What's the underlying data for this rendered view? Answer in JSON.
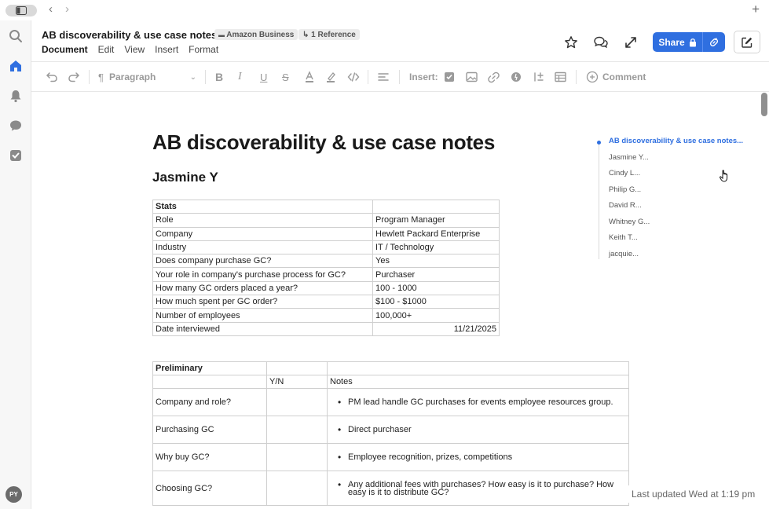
{
  "window": {
    "back_arrow": "‹",
    "forward_arrow": "›",
    "new_tab": "+"
  },
  "doc": {
    "title": "AB discoverability & use case notes",
    "folder_chip": "Amazon Business",
    "reference_chip": "1 Reference"
  },
  "menu": [
    "Document",
    "Edit",
    "View",
    "Insert",
    "Format"
  ],
  "share": {
    "label": "Share"
  },
  "toolbar": {
    "paragraph_style": "Paragraph",
    "insert_label": "Insert:",
    "comment_label": "Comment"
  },
  "content": {
    "heading": "AB discoverability & use case notes",
    "subheading": "Jasmine Y",
    "stats_table": {
      "header": "Stats",
      "rows": [
        [
          "Role",
          "Program Manager"
        ],
        [
          "Company",
          "Hewlett Packard Enterprise"
        ],
        [
          "Industry",
          "IT / Technology"
        ],
        [
          "Does company purchase GC?",
          "Yes"
        ],
        [
          "Your role in company's purchase process for GC?",
          "Purchaser"
        ],
        [
          "How many GC orders placed a year?",
          "100 - 1000"
        ],
        [
          "How much spent per GC order?",
          "$100 - $1000"
        ],
        [
          "Number of employees",
          "100,000+"
        ],
        [
          "Date interviewed",
          "11/21/2025"
        ]
      ]
    },
    "prelim_table": {
      "header": "Preliminary",
      "col_yn": "Y/N",
      "col_notes": "Notes",
      "rows": [
        {
          "question": "Company and role?",
          "yn": "",
          "notes": [
            "PM lead handle GC purchases for events employee resources group."
          ]
        },
        {
          "question": "Purchasing GC",
          "yn": "",
          "notes": [
            " Direct purchaser"
          ]
        },
        {
          "question": "Why buy GC?",
          "yn": "",
          "notes": [
            "Employee recognition, prizes, competitions"
          ]
        },
        {
          "question": "Choosing GC?",
          "yn": "",
          "notes": [
            "Any additional fees with purchases? How easy is it to purchase? How easy is it to distribute GC?"
          ]
        }
      ]
    }
  },
  "outline": {
    "items": [
      "AB discoverability & use case notes...",
      "Jasmine Y...",
      "Cindy L...",
      "Philip G...",
      "David R...",
      "Whitney G...",
      "Keith T...",
      "jacquie..."
    ]
  },
  "status": {
    "last_updated": "Last updated Wed at 1:19 pm"
  },
  "user": {
    "initials": "PY"
  },
  "colors": {
    "accent": "#2f6fe0",
    "rail_active": "#2f6fe0",
    "rail_icon": "#8a8a8a"
  }
}
